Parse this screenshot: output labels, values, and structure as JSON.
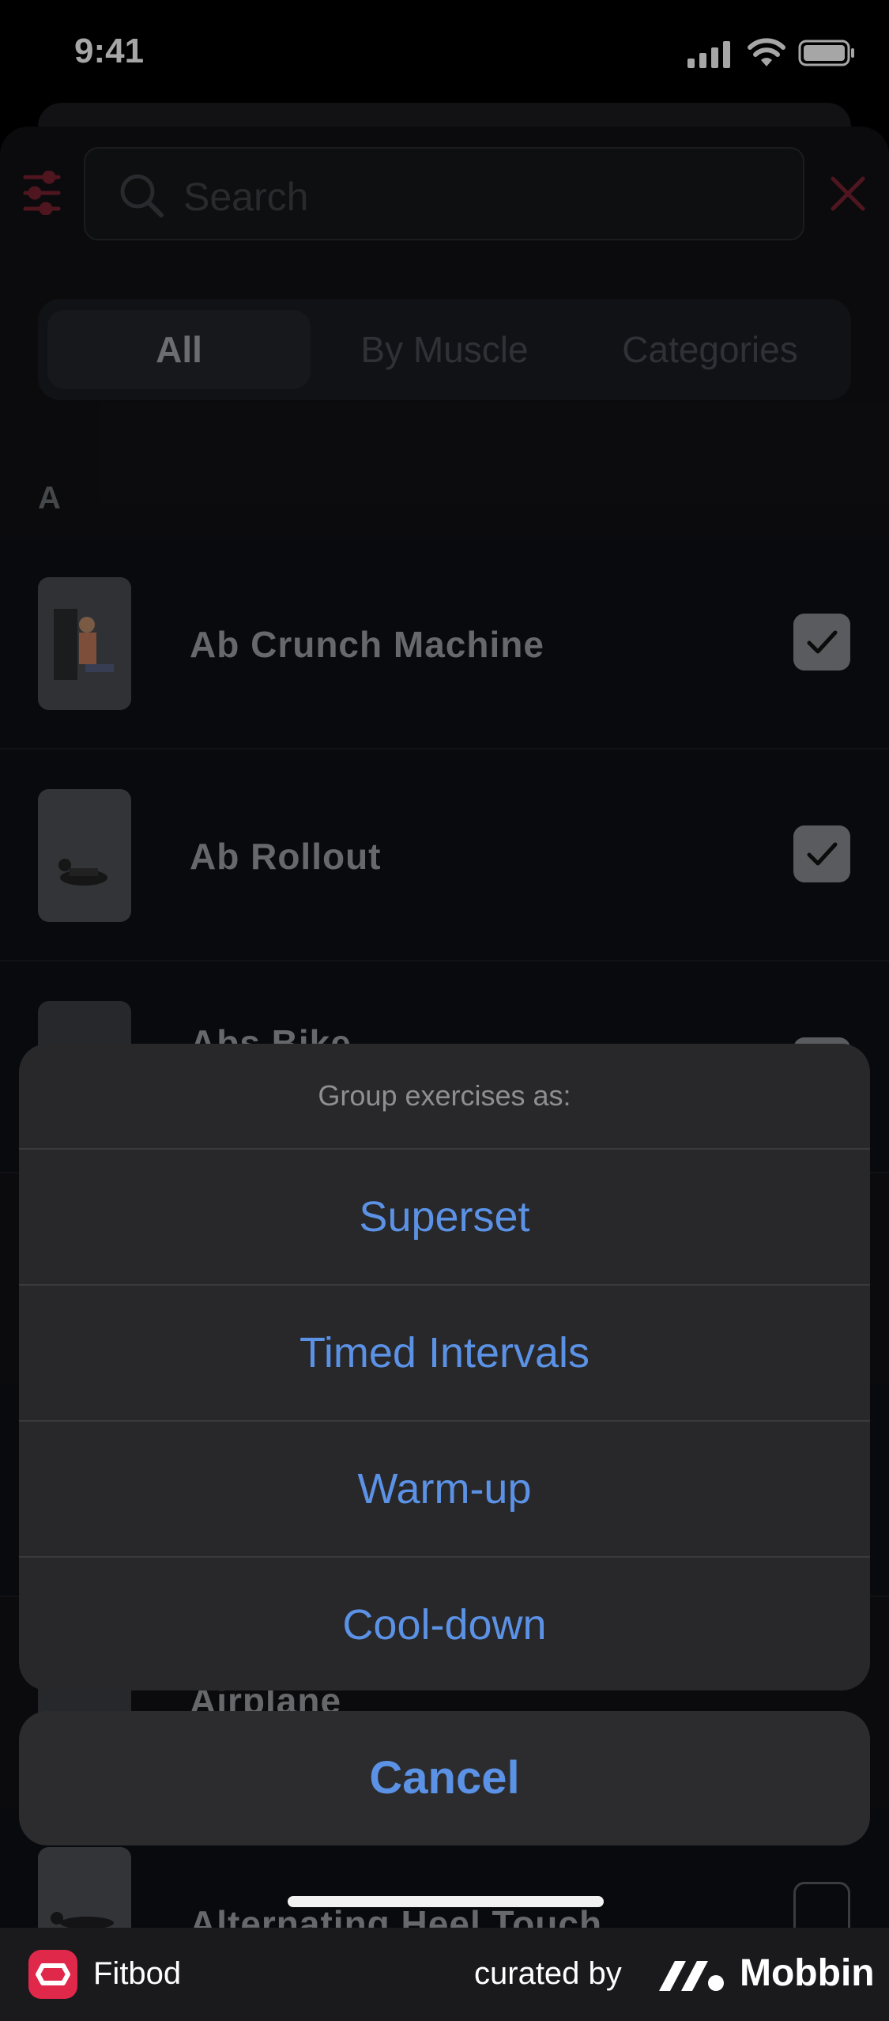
{
  "status_bar": {
    "time": "9:41"
  },
  "search": {
    "placeholder": "Search"
  },
  "segments": {
    "all": "All",
    "by_muscle": "By Muscle",
    "categories": "Categories",
    "selected": "All"
  },
  "section_letter": "A",
  "exercises": [
    {
      "name": "Ab Crunch Machine",
      "checked": true
    },
    {
      "name": "Ab Rollout",
      "checked": true
    },
    {
      "name": "Abs Bike",
      "checked": true
    },
    {
      "name": "Airplane",
      "checked": false
    },
    {
      "name": "Alternating Heel Touch",
      "checked": false
    }
  ],
  "action_sheet": {
    "title": "Group exercises as:",
    "options": [
      "Superset",
      "Timed Intervals",
      "Warm-up",
      "Cool-down"
    ],
    "cancel": "Cancel"
  },
  "footer": {
    "app_name": "Fitbod",
    "curated_by": "curated by",
    "mobbin": "Mobbin"
  },
  "colors": {
    "accent_red": "#c8283f",
    "action_blue": "#5b92e6"
  }
}
